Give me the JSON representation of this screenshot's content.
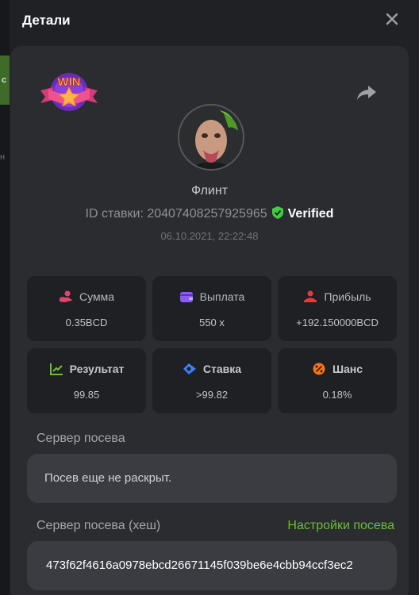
{
  "background": {
    "strip_text": "с",
    "strip_text2": "н"
  },
  "modal": {
    "title": "Детали",
    "close_icon": "close-icon",
    "badge": "WIN",
    "share_icon": "share-icon",
    "username": "Флинт",
    "bet_id_label": "ID ставки:",
    "bet_id": "20407408257925965",
    "verified_label": "Verified",
    "date": "06.10.2021, 22:22:48",
    "stats": [
      {
        "label": "Сумма",
        "value": "0.35BCD",
        "icon": "coins-hand-icon",
        "color": "#e2466f"
      },
      {
        "label": "Выплата",
        "value": "550 x",
        "icon": "wallet-icon",
        "color": "#8b5cf6"
      },
      {
        "label": "Прибыль",
        "value": "+192.150000BCD",
        "icon": "profit-user-icon",
        "color": "#e53b3b"
      },
      {
        "label": "Результат",
        "value": "99.85",
        "icon": "chart-result-icon",
        "color": "#6cbf34"
      },
      {
        "label": "Ставка",
        "value": ">99.82",
        "icon": "bet-ticket-icon",
        "color": "#3b82f6"
      },
      {
        "label": "Шанс",
        "value": "0.18%",
        "icon": "percent-icon",
        "color": "#f97316"
      }
    ],
    "server_seed_label": "Сервер посева",
    "server_seed_value": "Посев еще не раскрыт.",
    "server_seed_hash_label": "Сервер посева (хеш)",
    "seed_settings_link": "Настройки посева",
    "server_seed_hash": "473f62f4616a0978ebcd26671145f039be6e4cbb94ccf3ec2"
  }
}
